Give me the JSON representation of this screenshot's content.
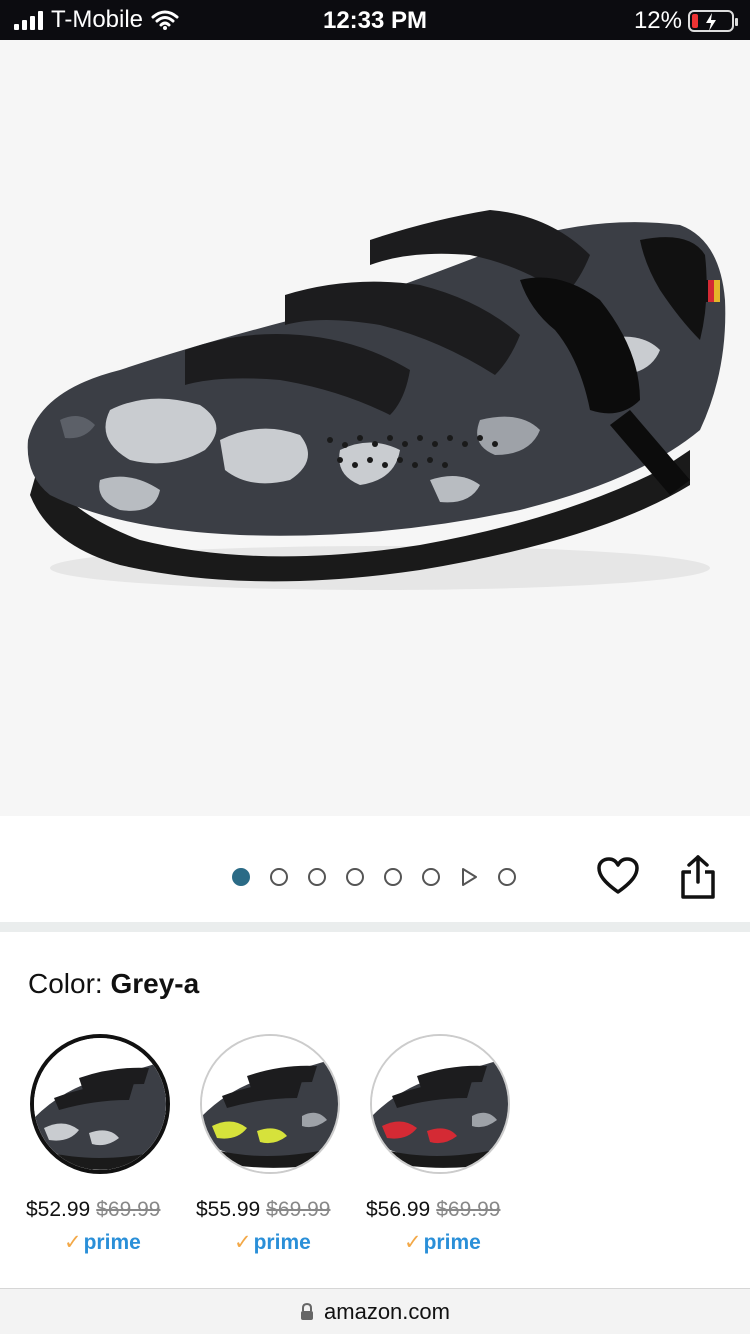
{
  "status_bar": {
    "carrier": "T-Mobile",
    "time": "12:33 PM",
    "battery": "12%"
  },
  "carousel": {
    "image_count": 8,
    "active_index": 0,
    "video_index": 6
  },
  "color_section": {
    "label": "Color:",
    "selected": "Grey-a"
  },
  "swatches": [
    {
      "name": "Grey-a",
      "price": "$52.99",
      "list_price": "$69.99",
      "prime": "prime",
      "accent": "#c9ccd0"
    },
    {
      "name": "Yellow",
      "price": "$55.99",
      "list_price": "$69.99",
      "prime": "prime",
      "accent": "#d6e23b"
    },
    {
      "name": "Red",
      "price": "$56.99",
      "list_price": "$69.99",
      "prime": "prime",
      "accent": "#d42a34"
    }
  ],
  "url_bar": {
    "domain": "amazon.com"
  },
  "colors": {
    "active_dot": "#2b6b86",
    "prime_blue": "#2a8fd8",
    "prime_check": "#f3a847"
  }
}
